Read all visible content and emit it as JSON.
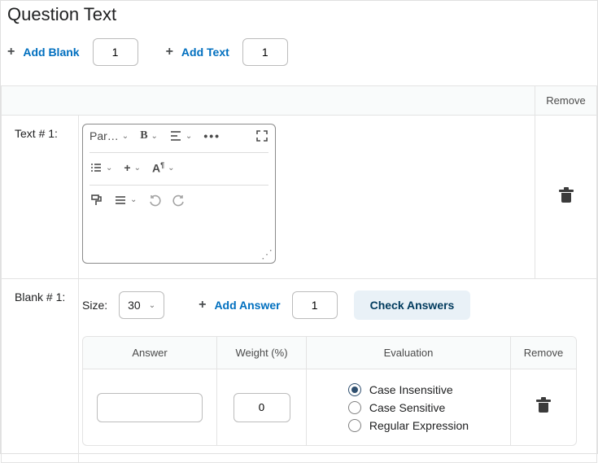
{
  "heading": "Question Text",
  "toolbar": {
    "add_blank_label": "Add Blank",
    "add_blank_value": "1",
    "add_text_label": "Add Text",
    "add_text_value": "1"
  },
  "columns": {
    "remove": "Remove"
  },
  "text_row": {
    "label": "Text # 1:",
    "editor": {
      "paragraph": "Par…"
    }
  },
  "blank_row": {
    "label": "Blank # 1:",
    "size_label": "Size:",
    "size_value": "30",
    "add_answer_label": "Add Answer",
    "add_answer_value": "1",
    "check_answers_label": "Check Answers",
    "answer_table": {
      "cols": {
        "answer": "Answer",
        "weight": "Weight (%)",
        "evaluation": "Evaluation",
        "remove": "Remove"
      },
      "rows": [
        {
          "answer": "",
          "weight": "0",
          "evaluation_selected": 0,
          "evaluation_options": [
            "Case Insensitive",
            "Case Sensitive",
            "Regular Expression"
          ]
        }
      ]
    }
  }
}
